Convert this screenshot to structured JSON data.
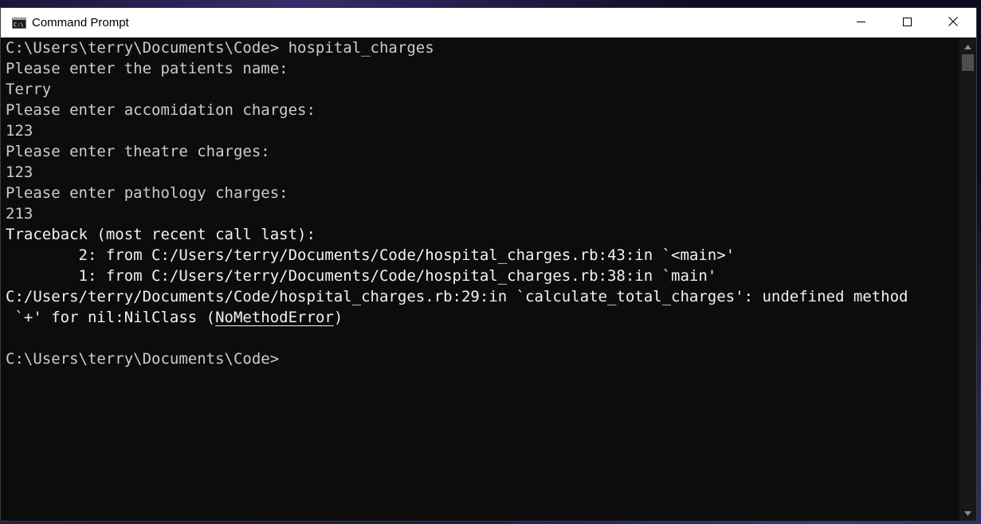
{
  "window": {
    "title": "Command Prompt"
  },
  "console": {
    "line0": "C:\\Users\\terry\\Documents\\Code> hospital_charges",
    "line1": "Please enter the patients name:",
    "line2": "Terry",
    "line3": "Please enter accomidation charges:",
    "line4": "123",
    "line5": "Please enter theatre charges:",
    "line6": "123",
    "line7": "Please enter pathology charges:",
    "line8": "213",
    "line9": "Traceback (most recent call last):",
    "line10": "        2: from C:/Users/terry/Documents/Code/hospital_charges.rb:43:in `<main>'",
    "line11": "        1: from C:/Users/terry/Documents/Code/hospital_charges.rb:38:in `main'",
    "line12a": "C:/Users/terry/Documents/Code/hospital_charges.rb:29:in `calculate_total_charges': ",
    "line12b": "undefined method",
    "line13a": " `+' for nil:NilClass (",
    "line13b": "NoMethodError",
    "line13c": ")",
    "line14": "",
    "line15": "C:\\Users\\terry\\Documents\\Code>"
  },
  "icons": {
    "app": "cmd-icon",
    "minimize": "minimize-icon",
    "maximize": "maximize-icon",
    "close": "close-icon"
  },
  "colors": {
    "console_bg": "#0c0c0c",
    "console_text": "#cccccc",
    "titlebar_bg": "#ffffff"
  }
}
